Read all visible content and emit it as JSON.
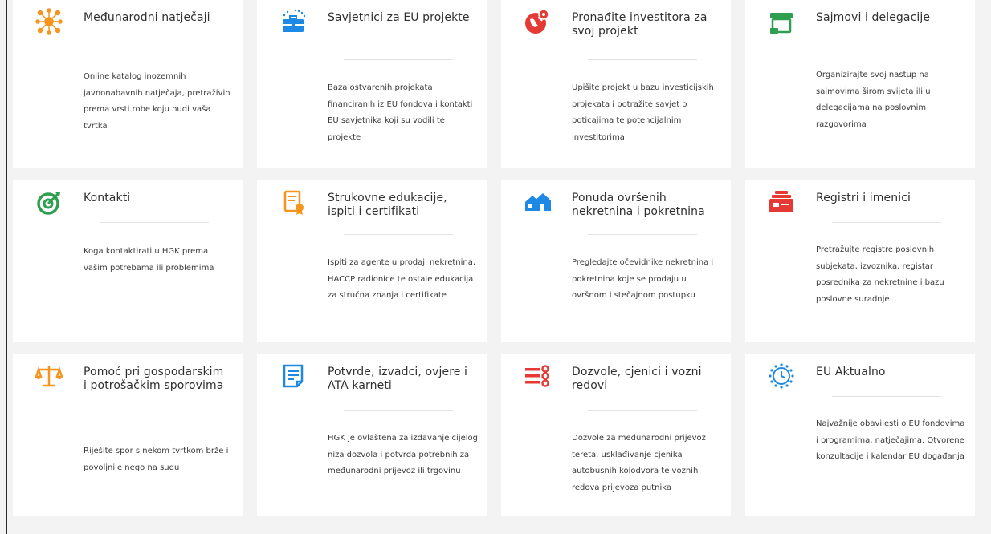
{
  "cards": [
    {
      "title": "Međunarodni natječaji",
      "desc": "Online katalog inozemnih javnonabavnih natječaja, pretraživih prema vrsti robe koju nudi vaša tvrtka",
      "icon": "network-icon",
      "color": "#f7941d"
    },
    {
      "title": "Savjetnici za EU projekte",
      "desc": "Baza ostvarenih projekata financiranih iz EU fondova i kontakti EU savjetnika koji su vodili te projekte",
      "icon": "briefcase-icon",
      "color": "#1e88e5"
    },
    {
      "title": "Pronađite investitora za svoj projekt",
      "desc": "Upišite projekt u bazu investicijskih projekata i potražite savjet o poticajima te potencijalnim investitorima",
      "icon": "globe-pin-icon",
      "color": "#e53935"
    },
    {
      "title": "Sajmovi i delegacije",
      "desc": "Organizirajte svoj nastup na sajmovima širom svijeta ili u delegacijama na poslovnim razgovorima",
      "icon": "fair-stand-icon",
      "color": "#2e9e4f"
    },
    {
      "title": "Kontakti",
      "desc": "Koga kontaktirati u HGK prema vašim potrebama ili problemima",
      "icon": "target-icon",
      "color": "#2e9e4f"
    },
    {
      "title": "Strukovne edukacije, ispiti i certifikati",
      "desc": "Ispiti za agente u prodaji nekretnina, HACCP radionice te ostale edukacija za stručna znanja i certifikate",
      "icon": "certificate-icon",
      "color": "#f7941d"
    },
    {
      "title": "Ponuda ovršenih nekretnina i pokretnina",
      "desc": "Pregledajte očevidnike nekretnina i pokretnina koje se prodaju u ovršnom i stečajnom postupku",
      "icon": "houses-icon",
      "color": "#1e88e5"
    },
    {
      "title": "Registri i imenici",
      "desc": "Pretražujte registre poslovnih subjekata, izvoznika, registar posrednika za nekretnine i bazu poslovne suradnje",
      "icon": "register-icon",
      "color": "#e53935"
    },
    {
      "title": "Pomoć pri gospodarskim i potrošačkim sporovima",
      "desc": "Riješite spor s nekom tvrtkom brže i povoljnije nego na sudu",
      "icon": "scales-icon",
      "color": "#f7941d"
    },
    {
      "title": "Potvrde, izvadci, ovjere i ATA karneti",
      "desc": "HGK je ovlaštena za izdavanje cijelog niza dozvola i potvrda potrebnih za međunarodni prijevoz ili trgovinu",
      "icon": "document-icon",
      "color": "#1e88e5"
    },
    {
      "title": "Dozvole, cjenici i vozni redovi",
      "desc": "Dozvole za međunarodni prijevoz tereta, usklađivanje cjenika autobusnih kolodvora te voznih redova prijevoza putnika",
      "icon": "list-settings-icon",
      "color": "#e53935"
    },
    {
      "title": "EU Aktualno",
      "desc": "Najvažnije obavijesti o EU fondovima i programima, natječajima. Otvorene konzultacije i kalendar EU događanja",
      "icon": "eu-stars-icon",
      "color": "#1e88e5"
    }
  ]
}
